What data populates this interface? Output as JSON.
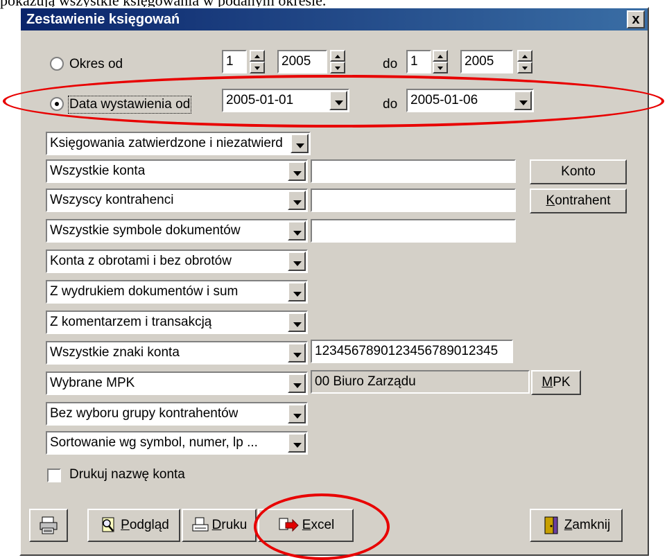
{
  "document": {
    "caption_fragment": "pokazują wszystkie księgowania w podanym okresie."
  },
  "window": {
    "title": "Zestawienie księgowań",
    "close_glyph": "x"
  },
  "period": {
    "label": "Okres od",
    "from_month": "1",
    "from_year": "2005",
    "to_label": "do",
    "to_month": "1",
    "to_year": "2005"
  },
  "issue_date": {
    "label": "Data wystawienia od",
    "from": "2005-01-01",
    "to_label": "do",
    "to": "2005-01-06"
  },
  "filters": {
    "postings": "Księgowania zatwierdzone i niezatwierd",
    "accounts": "Wszystkie konta",
    "contractors": "Wszyscy kontrahenci",
    "doc_symbols": "Wszystkie symbole dokumentów",
    "turnover": "Konta z obrotami i bez obrotów",
    "printout": "Z wydrukiem dokumentów i sum",
    "comment": "Z komentarzem i transakcją",
    "account_chars": "Wszystkie znaki konta",
    "account_chars_value": "12345678901234567890123​45",
    "mpk": "Wybrane MPK",
    "mpk_value": "00  Biuro Zarządu",
    "contractor_group": "Bez wyboru grupy kontrahentów",
    "sorting": "Sortowanie wg symbol, numer, lp ..."
  },
  "buttons": {
    "konto": "Konto",
    "kontrahent_k": "K",
    "kontrahent_rest": "ontrahent",
    "mpk_m": "M",
    "mpk_rest": "PK",
    "podglad_p": "P",
    "podglad_rest": "odgląd",
    "druku_d": "D",
    "druku_rest": "ruku",
    "excel_e": "E",
    "excel_rest": "xcel",
    "zamknij_z": "Z",
    "zamknij_rest": "amknij"
  },
  "print_account_name": {
    "label": "Drukuj nazwę konta",
    "checked": false
  },
  "annotations": {
    "color": "#e80000"
  }
}
